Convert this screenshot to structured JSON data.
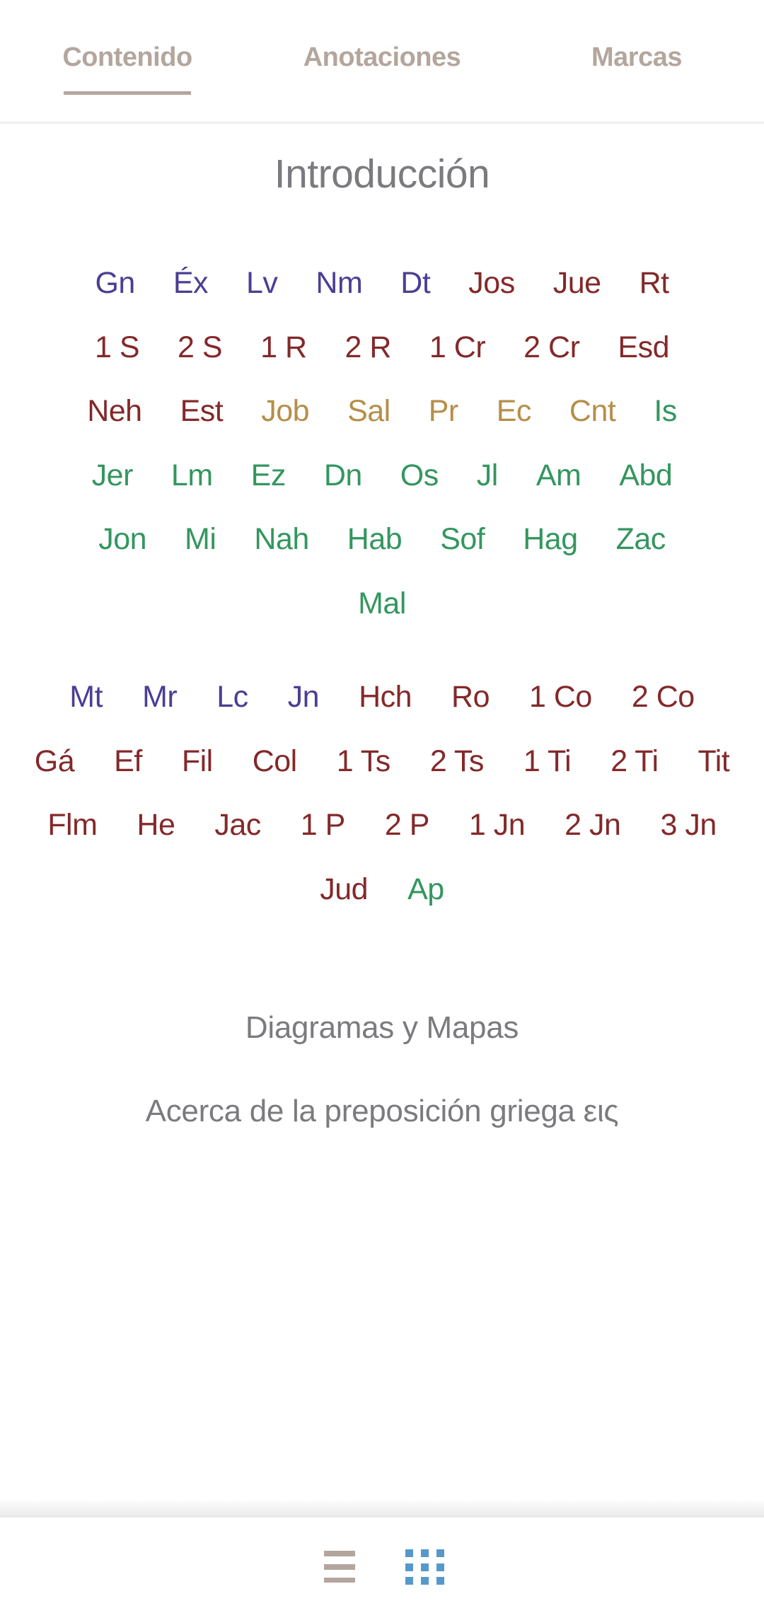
{
  "tabs": [
    {
      "label": "Contenido",
      "active": true
    },
    {
      "label": "Anotaciones",
      "active": false
    },
    {
      "label": "Marcas",
      "active": false
    }
  ],
  "content": {
    "intro_title": "Introducción",
    "old_testament": [
      {
        "abbr": "Gn",
        "group": "law"
      },
      {
        "abbr": "Éx",
        "group": "law"
      },
      {
        "abbr": "Lv",
        "group": "law"
      },
      {
        "abbr": "Nm",
        "group": "law"
      },
      {
        "abbr": "Dt",
        "group": "law"
      },
      {
        "abbr": "Jos",
        "group": "hist"
      },
      {
        "abbr": "Jue",
        "group": "hist"
      },
      {
        "abbr": "Rt",
        "group": "hist"
      },
      {
        "abbr": "1 S",
        "group": "hist"
      },
      {
        "abbr": "2 S",
        "group": "hist"
      },
      {
        "abbr": "1 R",
        "group": "hist"
      },
      {
        "abbr": "2 R",
        "group": "hist"
      },
      {
        "abbr": "1 Cr",
        "group": "hist"
      },
      {
        "abbr": "2 Cr",
        "group": "hist"
      },
      {
        "abbr": "Esd",
        "group": "hist"
      },
      {
        "abbr": "Neh",
        "group": "hist"
      },
      {
        "abbr": "Est",
        "group": "hist"
      },
      {
        "abbr": "Job",
        "group": "poet"
      },
      {
        "abbr": "Sal",
        "group": "poet"
      },
      {
        "abbr": "Pr",
        "group": "poet"
      },
      {
        "abbr": "Ec",
        "group": "poet"
      },
      {
        "abbr": "Cnt",
        "group": "poet"
      },
      {
        "abbr": "Is",
        "group": "proph"
      },
      {
        "abbr": "Jer",
        "group": "proph"
      },
      {
        "abbr": "Lm",
        "group": "proph"
      },
      {
        "abbr": "Ez",
        "group": "proph"
      },
      {
        "abbr": "Dn",
        "group": "proph"
      },
      {
        "abbr": "Os",
        "group": "proph"
      },
      {
        "abbr": "Jl",
        "group": "proph"
      },
      {
        "abbr": "Am",
        "group": "proph"
      },
      {
        "abbr": "Abd",
        "group": "proph"
      },
      {
        "abbr": "Jon",
        "group": "proph"
      },
      {
        "abbr": "Mi",
        "group": "proph"
      },
      {
        "abbr": "Nah",
        "group": "proph"
      },
      {
        "abbr": "Hab",
        "group": "proph"
      },
      {
        "abbr": "Sof",
        "group": "proph"
      },
      {
        "abbr": "Hag",
        "group": "proph"
      },
      {
        "abbr": "Zac",
        "group": "proph"
      },
      {
        "abbr": "Mal",
        "group": "proph"
      }
    ],
    "new_testament": [
      {
        "abbr": "Mt",
        "group": "law"
      },
      {
        "abbr": "Mr",
        "group": "law"
      },
      {
        "abbr": "Lc",
        "group": "law"
      },
      {
        "abbr": "Jn",
        "group": "law"
      },
      {
        "abbr": "Hch",
        "group": "hist"
      },
      {
        "abbr": "Ro",
        "group": "hist"
      },
      {
        "abbr": "1 Co",
        "group": "hist"
      },
      {
        "abbr": "2 Co",
        "group": "hist"
      },
      {
        "abbr": "Gá",
        "group": "hist"
      },
      {
        "abbr": "Ef",
        "group": "hist"
      },
      {
        "abbr": "Fil",
        "group": "hist"
      },
      {
        "abbr": "Col",
        "group": "hist"
      },
      {
        "abbr": "1 Ts",
        "group": "hist"
      },
      {
        "abbr": "2 Ts",
        "group": "hist"
      },
      {
        "abbr": "1 Ti",
        "group": "hist"
      },
      {
        "abbr": "2 Ti",
        "group": "hist"
      },
      {
        "abbr": "Tit",
        "group": "hist"
      },
      {
        "abbr": "Flm",
        "group": "hist"
      },
      {
        "abbr": "He",
        "group": "hist"
      },
      {
        "abbr": "Jac",
        "group": "hist"
      },
      {
        "abbr": "1 P",
        "group": "hist"
      },
      {
        "abbr": "2 P",
        "group": "hist"
      },
      {
        "abbr": "1 Jn",
        "group": "hist"
      },
      {
        "abbr": "2 Jn",
        "group": "hist"
      },
      {
        "abbr": "3 Jn",
        "group": "hist"
      },
      {
        "abbr": "Jud",
        "group": "hist"
      },
      {
        "abbr": "Ap",
        "group": "proph"
      }
    ],
    "extra_links": [
      "Diagramas y Mapas",
      "Acerca de la preposición griega εις"
    ]
  },
  "group_colors": {
    "law": "#4a3f93",
    "hist": "#83292a",
    "poet": "#b68e48",
    "proph": "#34965f"
  },
  "bottom_nav": {
    "list_icon": "list-view-icon",
    "grid_icon": "grid-view-icon",
    "list_color": "#b4a69d",
    "grid_color": "#5599cc",
    "active": "grid"
  }
}
